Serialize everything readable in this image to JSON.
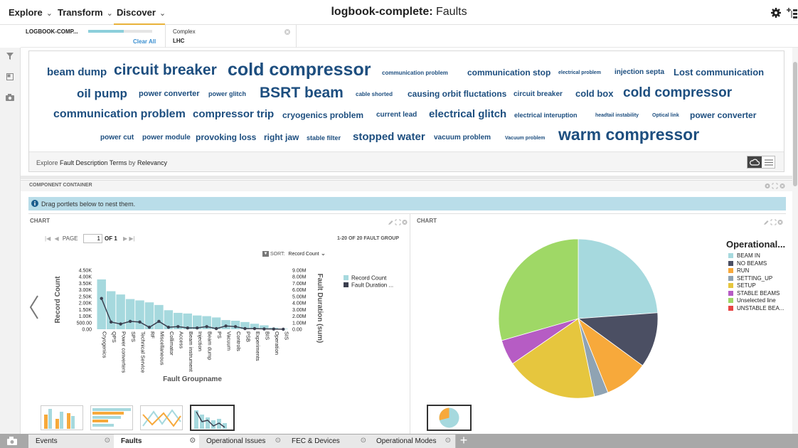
{
  "nav": {
    "items": [
      {
        "label": "Explore"
      },
      {
        "label": "Transform"
      },
      {
        "label": "Discover"
      }
    ]
  },
  "title": {
    "prefix": "logbook-complete:",
    "suffix": " Faults"
  },
  "filters": {
    "source_label": "LOGBOOK-COMP...",
    "progress": 0.55,
    "clear_all": "Clear All",
    "chip_label": "Complex",
    "chip_value": "LHC"
  },
  "wordcloud": {
    "rows": [
      [
        {
          "text": "beam dump"
        },
        {
          "text": "circuit breaker"
        },
        {
          "text": "cold compressor"
        },
        {
          "text": "communication problem"
        },
        {
          "text": "communication stop"
        },
        {
          "text": "electrical problem"
        },
        {
          "text": "injection septa"
        },
        {
          "text": "Lost communication"
        }
      ],
      [
        {
          "text": "oil pump"
        },
        {
          "text": "power converter"
        },
        {
          "text": "power glitch"
        },
        {
          "text": "BSRT beam"
        },
        {
          "text": "cable shorted"
        },
        {
          "text": "causing orbit fluctations"
        },
        {
          "text": "circuit breaker"
        },
        {
          "text": "cold box"
        },
        {
          "text": "cold compressor"
        }
      ],
      [
        {
          "text": "communication problem"
        },
        {
          "text": "compressor trip"
        },
        {
          "text": "cryogenics problem"
        },
        {
          "text": "current lead"
        },
        {
          "text": "electrical glitch"
        },
        {
          "text": "electrical interuption"
        },
        {
          "text": "headtail instability"
        },
        {
          "text": "Optical link"
        },
        {
          "text": "power converter"
        }
      ],
      [
        {
          "text": "power cut"
        },
        {
          "text": "power module"
        },
        {
          "text": "provoking loss"
        },
        {
          "text": "right jaw"
        },
        {
          "text": "stable filter"
        },
        {
          "text": "stopped water"
        },
        {
          "text": "vacuum problem"
        },
        {
          "text": "Vacuum problem"
        },
        {
          "text": "warm compressor"
        }
      ]
    ],
    "footer": {
      "explore": "Explore",
      "field": "Fault Description Terms",
      "by": "by",
      "sort": "Relevancy"
    }
  },
  "container": {
    "header": "COMPONENT CONTAINER",
    "info": "Drag portlets below to nest them."
  },
  "bar_chart": {
    "header": "CHART",
    "pager": {
      "page_label": "PAGE",
      "page_value": "1",
      "of_label": "OF 1",
      "range": "1-20 OF 20 FAULT GROUP"
    },
    "sort": {
      "label": "SORT:",
      "value": "Record Count"
    }
  },
  "pie_chart": {
    "header": "CHART"
  },
  "tabs": [
    {
      "label": "Events"
    },
    {
      "label": "Faults"
    },
    {
      "label": "Operational Issues"
    },
    {
      "label": "FEC & Devices"
    },
    {
      "label": "Operational Modes"
    }
  ],
  "colors": {
    "bar": "#a6d9de",
    "line": "#3b3f4f",
    "word": "#1d4e7f",
    "accent": "#e8b23a"
  },
  "icons": [
    "filter-icon",
    "panel-icon",
    "camera-icon",
    "gear-icon",
    "tree-add-icon",
    "cloud-icon",
    "list-icon",
    "pencil-icon",
    "expand-icon",
    "close-icon",
    "info-icon",
    "chevron-left-icon",
    "add-tab-icon"
  ],
  "chart_data": [
    {
      "type": "bar",
      "xlabel": "Fault Groupname",
      "ylabel": "Record Count",
      "y2label": "Fault Duration (sum)",
      "ylim": [
        0,
        4500
      ],
      "y2lim": [
        0,
        9000000
      ],
      "yticks": [
        "0.00",
        "500.00",
        "1.00K",
        "1.50K",
        "2.00K",
        "2.50K",
        "3.00K",
        "3.50K",
        "4.00K",
        "4.50K"
      ],
      "y2ticks": [
        "0.00",
        "1.00M",
        "2.00M",
        "3.00M",
        "4.00M",
        "5.00M",
        "6.00M",
        "7.00M",
        "8.00M",
        "9.00M"
      ],
      "categories": [
        "Cryogenics",
        "QPS",
        "Power converters",
        "SPS",
        "Technical Service",
        "RF",
        "Miscellaneous",
        "Collimator",
        "Access",
        "Beam instrument",
        "Injection",
        "Beam dump",
        "PS",
        "Vacuum",
        "Controls",
        "PSB",
        "Experiments",
        "BIS",
        "Operation",
        "SIS"
      ],
      "legend": [
        "Record Count",
        "Fault Duration ..."
      ],
      "series": [
        {
          "name": "Record Count",
          "values": [
            3800,
            2900,
            2650,
            2300,
            2200,
            2050,
            1850,
            1450,
            1250,
            1200,
            1050,
            1000,
            900,
            700,
            650,
            550,
            420,
            300,
            120,
            40
          ]
        },
        {
          "name": "Fault Duration ...",
          "values": [
            4700000,
            1100000,
            800000,
            1200000,
            1100000,
            300000,
            1200000,
            300000,
            400000,
            200000,
            200000,
            400000,
            100000,
            500000,
            400000,
            100000,
            100000,
            50000,
            30000,
            10000
          ]
        }
      ]
    },
    {
      "type": "pie",
      "title": "Operational...",
      "legend": [
        "BEAM IN",
        "NO BEAMS",
        "RUN",
        "SETTING_UP",
        "SETUP",
        "STABLE BEAMS",
        "Unselected line",
        "UNSTABLE BEA..."
      ],
      "colors": [
        "#a6d9de",
        "#4b4f63",
        "#f7a93b",
        "#8fa3b3",
        "#e6c63e",
        "#b65cc4",
        "#9fd866",
        "#e84545"
      ],
      "values": [
        25.5,
        12.0,
        9.5,
        3.0,
        20.0,
        5.5,
        31.5,
        0.0
      ]
    }
  ]
}
